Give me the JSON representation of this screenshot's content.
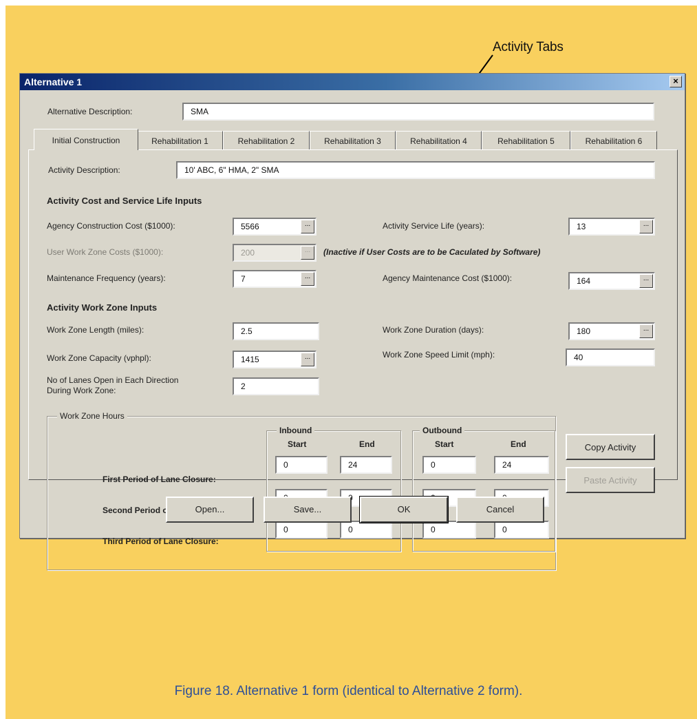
{
  "annotation": {
    "label": "Activity Tabs"
  },
  "dialog": {
    "title": "Alternative 1",
    "close_glyph": "×",
    "alt_description_label": "Alternative Description:",
    "alt_description_value": "SMA",
    "tabs": [
      "Initial Construction",
      "Rehabilitation 1",
      "Rehabilitation 2",
      "Rehabilitation 3",
      "Rehabilitation 4",
      "Rehabilitation 5",
      "Rehabilitation 6"
    ],
    "activity_description_label": "Activity Description:",
    "activity_description_value": "10' ABC, 6\" HMA, 2\" SMA",
    "cost_heading": "Activity Cost and Service Life Inputs",
    "agency_cost_label": "Agency Construction Cost ($1000):",
    "agency_cost_value": "5566",
    "service_life_label": "Activity Service Life (years):",
    "service_life_value": "13",
    "user_cost_label": "User Work Zone Costs ($1000):",
    "user_cost_value": "200",
    "user_cost_note": "(Inactive if User Costs are to be Caculated by Software)",
    "maint_freq_label": "Maintenance Frequency (years):",
    "maint_freq_value": "7",
    "maint_cost_label": "Agency Maintenance Cost ($1000):",
    "maint_cost_value": "164",
    "wz_heading": "Activity Work Zone Inputs",
    "wz_length_label": "Work Zone Length (miles):",
    "wz_length_value": "2.5",
    "wz_duration_label": "Work Zone Duration (days):",
    "wz_duration_value": "180",
    "wz_capacity_label": "Work Zone Capacity (vphpl):",
    "wz_capacity_value": "1415",
    "wz_speed_label": "Work Zone Speed Limit (mph):",
    "wz_speed_value": "40",
    "lanes_label_1": "No of Lanes Open in Each Direction",
    "lanes_label_2": "During Work Zone:",
    "lanes_value": "2",
    "ellipsis": "...",
    "hours": {
      "title": "Work Zone Hours",
      "inbound": "Inbound",
      "outbound": "Outbound",
      "start": "Start",
      "end": "End",
      "rows": [
        {
          "label": "First Period of Lane Closure:",
          "values": [
            "0",
            "24",
            "0",
            "24"
          ]
        },
        {
          "label": "Second Period of Lane Closure:",
          "values": [
            "0",
            "0",
            "0",
            "0"
          ]
        },
        {
          "label": "Third Period of Lane Closure:",
          "values": [
            "0",
            "0",
            "0",
            "0"
          ]
        }
      ]
    },
    "copy_activity": "Copy Activity",
    "paste_activity": "Paste Activity",
    "buttons": {
      "open": "Open...",
      "save": "Save...",
      "ok": "OK",
      "cancel": "Cancel"
    }
  },
  "caption": "Figure 18. Alternative 1 form (identical to Alternative 2 form)."
}
